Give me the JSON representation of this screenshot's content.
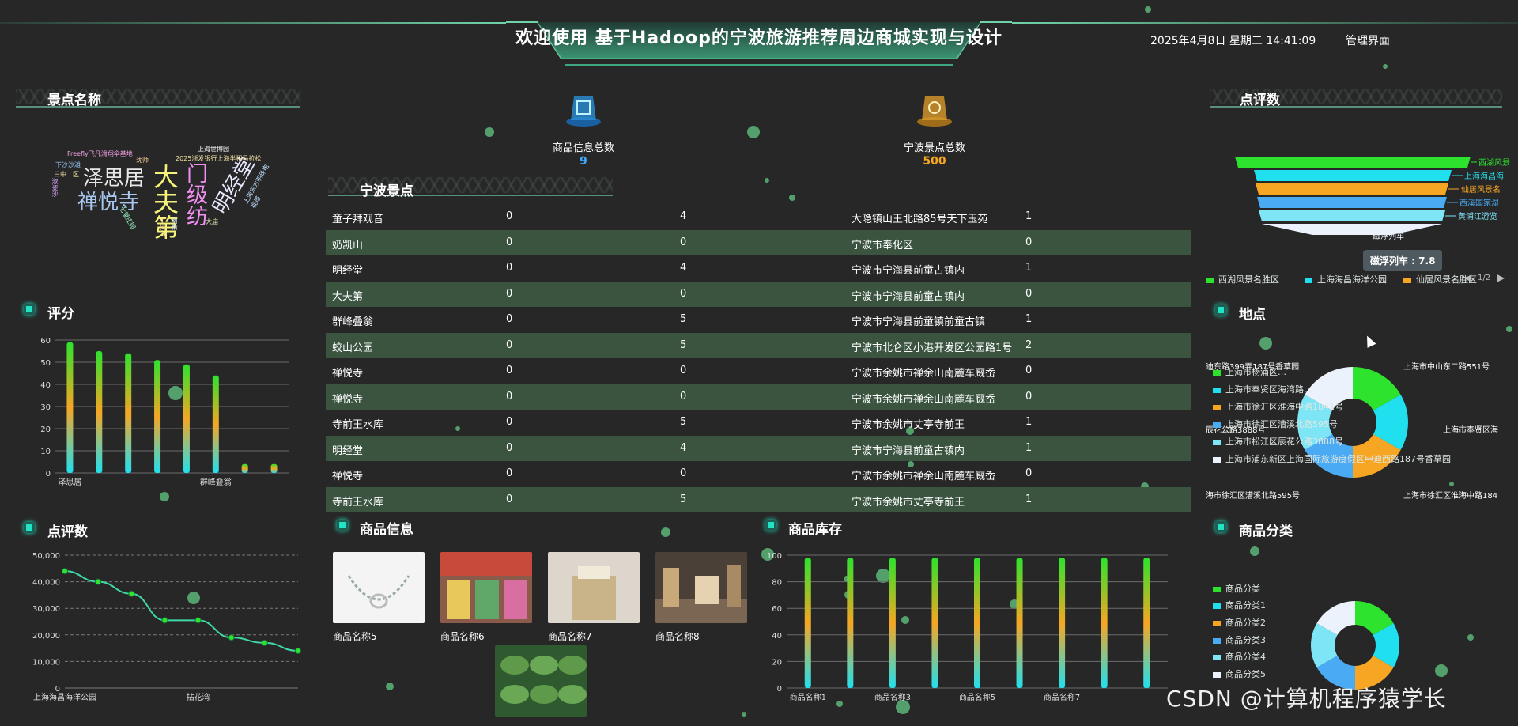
{
  "header": {
    "title": "欢迎使用 基于Hadoop的宁波旅游推荐周边商城实现与设计",
    "datetime": "2025年4月8日 星期二 14:41:09",
    "admin_link": "管理界面"
  },
  "panels": {
    "scenic_names": "景点名称",
    "rating": "评分",
    "reviews_left": "点评数",
    "reviews_right": "点评数",
    "ningbo_spots": "宁波景点",
    "products": "商品信息",
    "inventory": "商品库存",
    "location": "地点",
    "categories": "商品分类"
  },
  "stats": {
    "goods_label": "商品信息总数",
    "goods_value": "9",
    "spots_label": "宁波景点总数",
    "spots_value": "500"
  },
  "wordcloud": [
    "泽思居",
    "禅悦寺",
    "大夫第",
    "门级纺",
    "明经堂",
    "Freefly飞凡滑翔伞基地",
    "2025浙发银行上海半程马拉松",
    "上海世博园",
    "三中二区",
    "下沙沙滩",
    "淑姿沙",
    "七里庄园",
    "牛头山",
    "纳精",
    "大庙",
    "上海东方明珠电视塔",
    "沈师"
  ],
  "icons": {
    "goods_icon": "stack-box-icon",
    "spots_icon": "landmark-icon"
  },
  "spots_table": {
    "rows": [
      [
        "童子拜观音",
        "0",
        "4",
        "大隐镇山王北路85号天下玉苑",
        "1"
      ],
      [
        "奶凯山",
        "0",
        "0",
        "宁波市奉化区",
        "0"
      ],
      [
        "明经堂",
        "0",
        "4",
        "宁波市宁海县前童古镇内",
        "1"
      ],
      [
        "大夫第",
        "0",
        "0",
        "宁波市宁海县前童古镇内",
        "0"
      ],
      [
        "群峰叠翁",
        "0",
        "5",
        "宁波市宁海县前童镇前童古镇",
        "1"
      ],
      [
        "蛟山公园",
        "0",
        "5",
        "宁波市北仑区小港开发区公园路1号",
        "2"
      ],
      [
        "禅悦寺",
        "0",
        "0",
        "宁波市余姚市禅余山南麓车厩岙",
        "0"
      ],
      [
        "禅悦寺",
        "0",
        "0",
        "宁波市余姚市禅余山南麓车厩岙",
        "0"
      ],
      [
        "寺前王水库",
        "0",
        "5",
        "宁波市余姚市丈亭寺前王",
        "1"
      ],
      [
        "明经堂",
        "0",
        "4",
        "宁波市宁海县前童古镇内",
        "1"
      ],
      [
        "禅悦寺",
        "0",
        "0",
        "宁波市余姚市禅余山南麓车厩岙",
        "0"
      ],
      [
        "寺前王水库",
        "0",
        "5",
        "宁波市余姚市丈亭寺前王",
        "1"
      ]
    ]
  },
  "products": [
    {
      "name": "商品名称5",
      "image": "bracelet-photo"
    },
    {
      "name": "商品名称6",
      "image": "market-photo"
    },
    {
      "name": "商品名称7",
      "image": "gift-box-photo"
    },
    {
      "name": "商品名称8",
      "image": "shop-interior-photo"
    },
    {
      "name": "",
      "image": "dumplings-photo"
    }
  ],
  "funnel": {
    "labels": [
      "西湖风景",
      "上海海昌海",
      "仙居风景名",
      "西溪国家湿",
      "黄浦江游览",
      "磁浮列车"
    ],
    "legend": [
      "西湖风景名胜区",
      "上海海昌海洋公园",
      "仙居风景名胜区"
    ],
    "page": "1/2",
    "tooltip": "磁浮列车 : 7.8",
    "colors": [
      "#2de32d",
      "#20e0ef",
      "#f6a623",
      "#4aaaf4",
      "#7ee5f7",
      "#ecf2fb"
    ]
  },
  "location": {
    "legend": [
      "上海市杨浦区…",
      "上海市奉贤区海湾路…",
      "上海市徐汇区淮海中路1841号",
      "上海市徐汇区漕溪北路595号",
      "上海市松江区辰花公路3888号",
      "上海市浦东新区上海国际旅游度假区申迪西路187号香草园"
    ],
    "outer_labels": [
      "上海市中山东二路551号",
      "上海市奉贤区海",
      "上海市徐汇区淮海中路184",
      "海市徐汇区漕溪北路595号",
      "辰花公路3888号",
      "迪东路399弄187号香草园"
    ],
    "colors": [
      "#2de32d",
      "#20e0ef",
      "#f6a623",
      "#4aaaf4",
      "#7ee5f7",
      "#ecf2fb"
    ]
  },
  "categories": {
    "legend": [
      "商品分类",
      "商品分类1",
      "商品分类2",
      "商品分类3",
      "商品分类4",
      "商品分类5"
    ],
    "colors": [
      "#2de32d",
      "#20e0ef",
      "#f6a623",
      "#4aaaf4",
      "#7ee5f7",
      "#ecf2fb"
    ]
  },
  "watermark": "CSDN @计算机程序猿学长",
  "chart_data": [
    {
      "id": "rating",
      "type": "bar",
      "categories": [
        "泽思居",
        "",
        "",
        "",
        "",
        "群峰叠翁",
        "",
        ""
      ],
      "values": [
        59,
        55,
        54,
        51,
        49,
        44,
        4,
        4
      ],
      "ylim": [
        0,
        60
      ],
      "yticks": [
        "0",
        "10",
        "20",
        "30",
        "40",
        "50",
        "60"
      ]
    },
    {
      "id": "reviews",
      "type": "line",
      "categories": [
        "上海海昌海洋公园",
        "",
        "",
        "",
        "拈花湾",
        "",
        "",
        ""
      ],
      "values": [
        44000,
        40000,
        35500,
        25500,
        25500,
        19000,
        17000,
        14000
      ],
      "ylim": [
        0,
        50000
      ],
      "yticks": [
        "0",
        "10,000",
        "20,000",
        "30,000",
        "40,000",
        "50,000"
      ]
    },
    {
      "id": "inventory",
      "type": "bar",
      "categories": [
        "商品名称1",
        "",
        "商品名称3",
        "",
        "商品名称5",
        "",
        "商品名称7",
        "",
        ""
      ],
      "values": [
        98,
        98,
        98,
        98,
        98,
        98,
        98,
        98,
        98
      ],
      "ylim": [
        0,
        100
      ],
      "yticks": [
        "0",
        "20",
        "40",
        "60",
        "80",
        "100"
      ]
    }
  ]
}
